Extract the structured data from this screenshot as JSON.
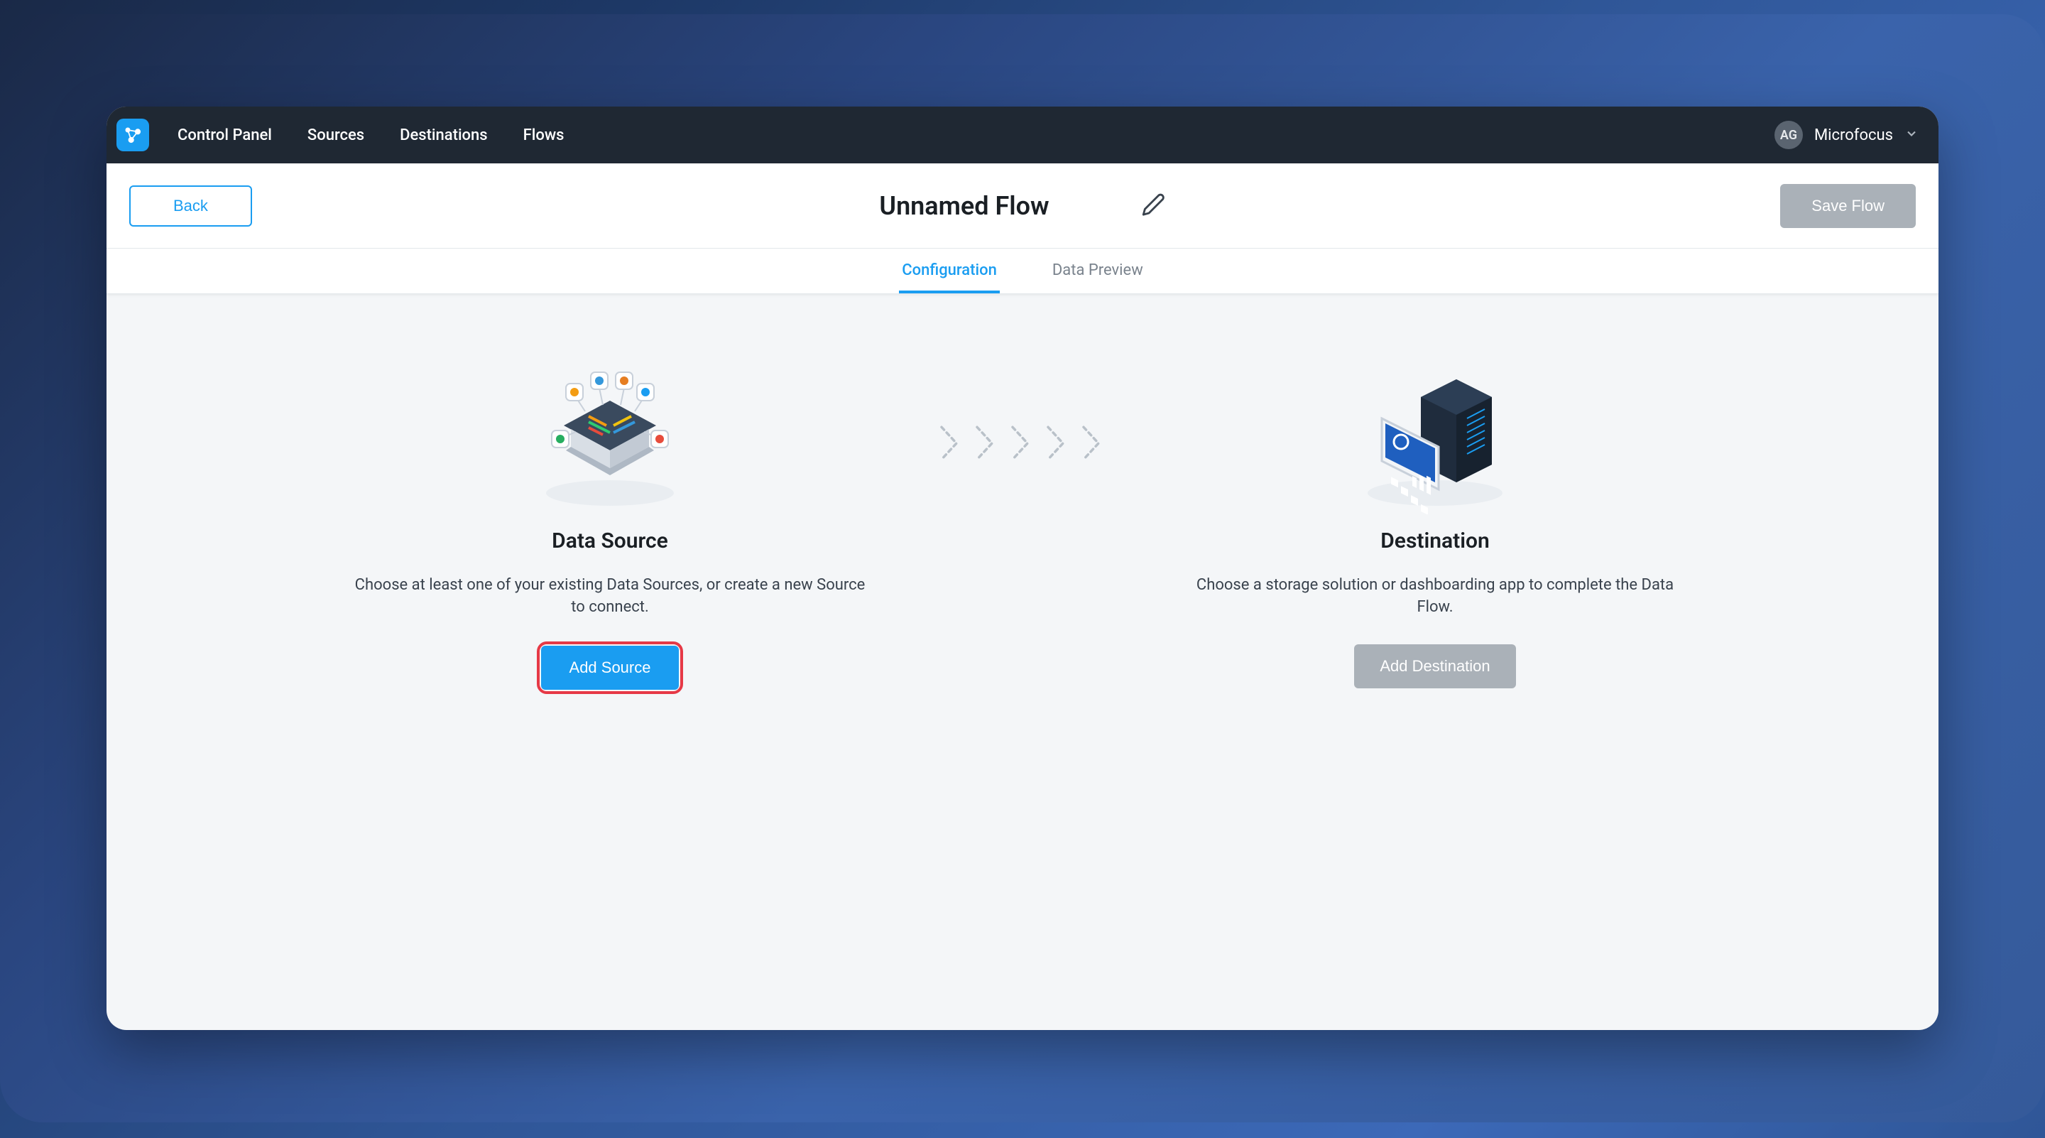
{
  "nav": {
    "links": [
      "Control Panel",
      "Sources",
      "Destinations",
      "Flows"
    ],
    "avatar_initials": "AG",
    "org": "Microfocus"
  },
  "titlebar": {
    "back": "Back",
    "title": "Unnamed Flow",
    "save": "Save Flow"
  },
  "tabs": {
    "config": "Configuration",
    "preview": "Data Preview"
  },
  "source_panel": {
    "title": "Data Source",
    "desc": "Choose at least one of your existing Data Sources, or create a new Source to connect.",
    "button": "Add Source"
  },
  "dest_panel": {
    "title": "Destination",
    "desc": "Choose a storage solution or dashboarding app to complete the Data Flow.",
    "button": "Add Destination"
  }
}
